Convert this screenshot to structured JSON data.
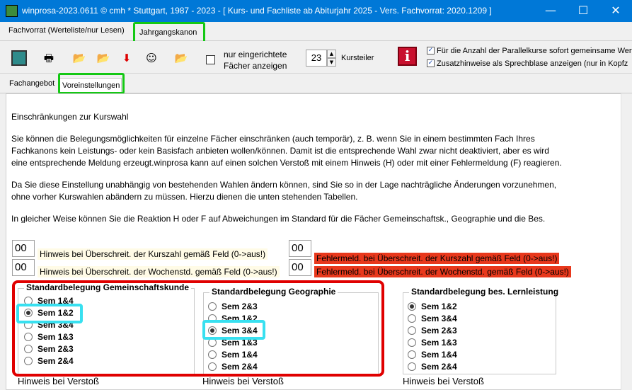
{
  "window": {
    "title": "winprosa-2023.0611 © cmh * Stuttgart, 1987 - 2023 - [ Kurs- und Fachliste ab Abiturjahr 2025 - Vers. Fachvorrat: 2020.1209 ]",
    "minimize": "—",
    "maximize": "☐",
    "close": "✕"
  },
  "top_tabs": [
    "Fachvorrat (Werteliste/nur Lesen)",
    "Jahrgangskanon"
  ],
  "toolbar": {
    "only_set_label_1": "nur eingerichtete",
    "only_set_label_2": "Fächer anzeigen",
    "spinner_value": "23",
    "kursteiler_label": "Kursteiler",
    "info_icon_text": "i",
    "check1_label": "Für die Anzahl der Parallelkurse sofort gemeinsame Wert",
    "check2_label": "Zusatzhinweise als Sprechblase anzeigen (nur in Kopfz",
    "check_mark": "✓"
  },
  "sub_tabs": [
    "Fachangebot",
    "Voreinstellungen"
  ],
  "content": {
    "heading": "Einschränkungen zur Kurswahl",
    "p1_l1": "Sie können die Belegungsmöglichkeiten für einzelne Fächer einschränken (auch temporär), z. B. wenn Sie in einem bestimmten Fach Ihres",
    "p1_l2": "Fachkanons kein Leistungs- oder kein Basisfach anbieten wollen/können. Damit ist die entsprechende Wahl zwar nicht deaktiviert, aber es wird",
    "p1_l3": "eine entsprechende Meldung erzeugt.winprosa kann auf einen  solchen Verstoß mit einem Hinweis (H) oder mit einer Fehlermeldung (F) reagieren.",
    "p2_l1": "Da Sie diese Einstellung unabhängig von bestehenden Wahlen ändern können, sind Sie so in der Lage nachträgliche Änderungen vorzunehmen,",
    "p2_l2": "ohne vorher Kurswahlen abändern zu müssen. Hierzu dienen die unten stehenden Tabellen.",
    "p3_l1": "In gleicher Weise können Sie die Reaktion H oder F auf Abweichungen im Standard für die Fächer Gemeinschaftsk., Geographie und die Bes."
  },
  "limits": {
    "h_kurszahl_value": "00",
    "h_kurszahl_label": "Hinweis bei Überschreit. der Kurszahl gemäß Feld (0->aus!)",
    "h_wochenstd_value": "00",
    "h_wochenstd_label": "Hinweis bei Überschreit. der Wochenstd. gemäß Feld (0->aus!)",
    "f_kurszahl_value": "00",
    "f_kurszahl_label": "Fehlermeld. bei Überschreit. der Kurszahl gemäß Feld (0->aus!)",
    "f_wochenstd_value": "00",
    "f_wochenstd_label": "Fehlermeld. bei Überschreit. der Wochenstd. gemäß Feld (0->aus!)"
  },
  "groups": [
    {
      "title": "Standardbelegung  Gemeinschaftskunde",
      "options": [
        "Sem 1&4",
        "Sem 1&2",
        "Sem 3&4",
        "Sem 1&3",
        "Sem 2&3",
        "Sem 2&4"
      ],
      "selected": 1,
      "footer": "Hinweis bei Verstoß"
    },
    {
      "title": "Standardbelegung  Geographie",
      "options": [
        "Sem 2&3",
        "Sem 1&2",
        "Sem 3&4",
        "Sem 1&3",
        "Sem 1&4",
        "Sem 2&4"
      ],
      "selected": 2,
      "footer": "Hinweis bei Verstoß"
    },
    {
      "title": "Standardbelegung bes. Lernleistung",
      "options": [
        "Sem 1&2",
        "Sem 3&4",
        "Sem 2&3",
        "Sem 1&3",
        "Sem 1&4",
        "Sem 2&4"
      ],
      "selected": 0,
      "footer": "Hinweis bei Verstoß"
    }
  ],
  "colors": {
    "titlebar": "#0078d7",
    "highlight_green": "#14c814",
    "highlight_red": "#e00000",
    "highlight_cyan": "#38e0f0",
    "error_bg": "#e8381c",
    "hint_bg": "#fffbe6"
  }
}
